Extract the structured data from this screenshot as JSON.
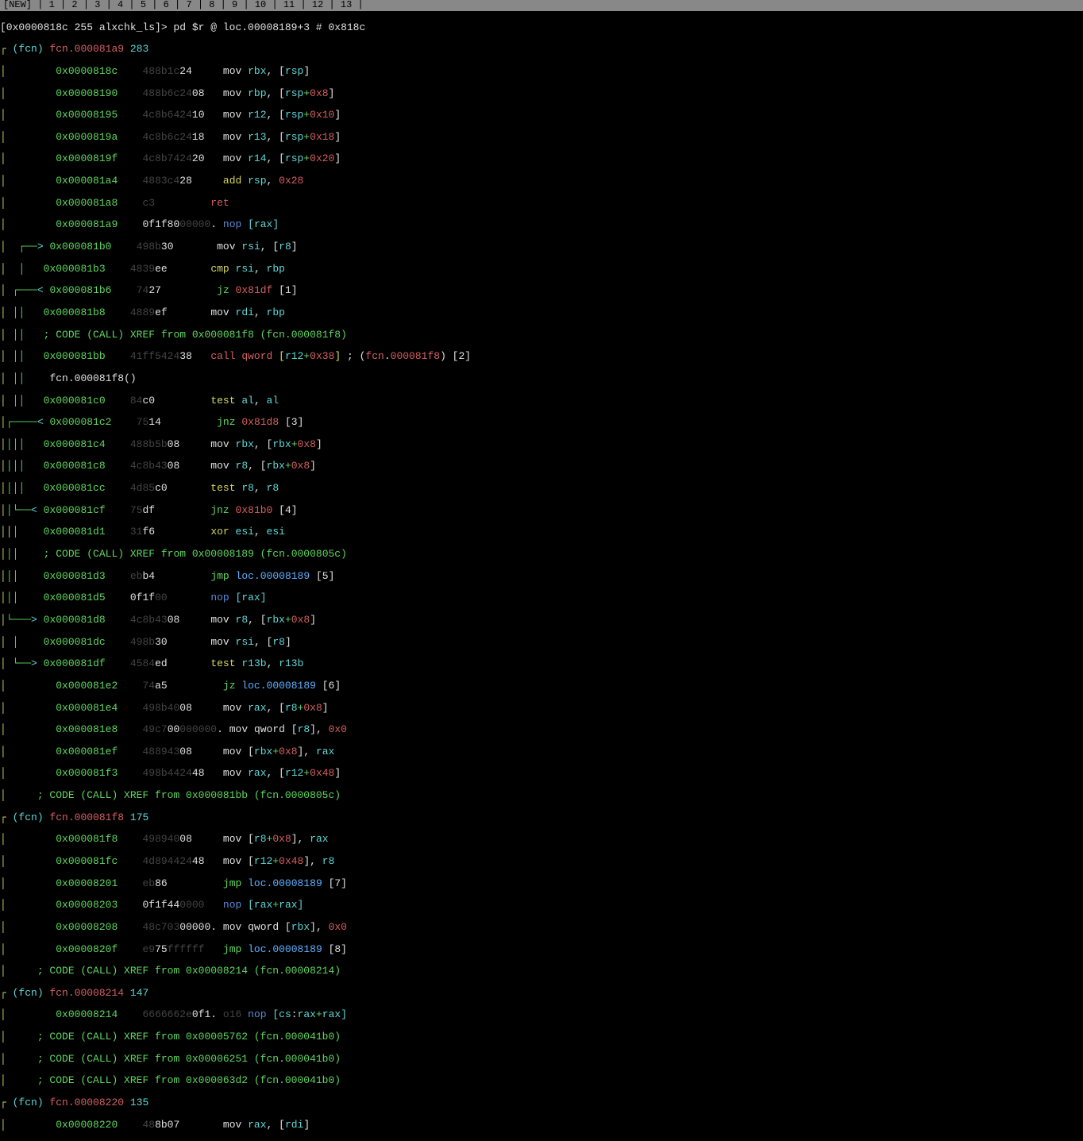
{
  "tabbar": "[NEW] | 1 | 2 | 3 | 4 | 5 | 6 | 7 | 8 | 9 | 10 | 11 | 12 | 13 |",
  "prompt": "[0x0000818c 255 alxchk_ls]> pd $r @ loc.00008189+3 # 0x818c",
  "fcn1": {
    "label": "(fcn)",
    "name": "fcn.000081a9",
    "size": "283"
  },
  "fcn2": {
    "label": "(fcn)",
    "name": "fcn.000081f8",
    "size": "175"
  },
  "fcn3": {
    "label": "(fcn)",
    "name": "fcn.00008214",
    "size": "147"
  },
  "fcn4": {
    "label": "(fcn)",
    "name": "fcn.00008220",
    "size": "135"
  },
  "lines": {
    "l01": {
      "addr": "0x0000818c",
      "hex1": "488b1c",
      "hex2": "24",
      "mn": "mov",
      "op": "rbx, [rsp]"
    },
    "l02": {
      "addr": "0x00008190",
      "hex1": "488b6c24",
      "hex2": "08",
      "mn": "mov",
      "op": "rbp, [rsp+0x8]"
    },
    "l03": {
      "addr": "0x00008195",
      "hex1": "4c8b6424",
      "hex2": "10",
      "mn": "mov",
      "op": "r12, [rsp+0x10]"
    },
    "l04": {
      "addr": "0x0000819a",
      "hex1": "4c8b6c24",
      "hex2": "18",
      "mn": "mov",
      "op": "r13, [rsp+0x18]"
    },
    "l05": {
      "addr": "0x0000819f",
      "hex1": "4c8b7424",
      "hex2": "20",
      "mn": "mov",
      "op": "r14, [rsp+0x20]"
    },
    "l06": {
      "addr": "0x000081a4",
      "hex1": "4883c4",
      "hex2": "28",
      "mn": "add",
      "op": "rsp, 0x28"
    },
    "l07": {
      "addr": "0x000081a8",
      "hex1": "c3",
      "mn": "ret"
    },
    "l08": {
      "addr": "0x000081a9",
      "hex1": "0f1f80",
      "hex2": "00000.",
      "mn": "nop",
      "op": "[rax]"
    },
    "l09": {
      "addr": "0x000081b0",
      "hex1": "498b",
      "hex2": "30",
      "mn": "mov",
      "op": "rsi, [r8]"
    },
    "l10": {
      "addr": "0x000081b3",
      "hex1": "4839",
      "hex2": "ee",
      "mn": "cmp",
      "op": "rsi, rbp"
    },
    "l11": {
      "addr": "0x000081b6",
      "hex1": "74",
      "hex2": "27",
      "mn": "jz",
      "op": "0x81df [1]"
    },
    "l12": {
      "addr": "0x000081b8",
      "hex1": "4889",
      "hex2": "ef",
      "mn": "mov",
      "op": "rdi, rbp"
    },
    "xref1": "; CODE (CALL) XREF from 0x000081f8 (fcn.000081f8)",
    "l13": {
      "addr": "0x000081bb",
      "hex1": "41ff5424",
      "hex2": "38",
      "mn": "call",
      "op": "qword [r12+0x38]",
      "cmt": "; (fcn.000081f8) [2]"
    },
    "fcncall": "fcn.000081f8()",
    "l14": {
      "addr": "0x000081c0",
      "hex1": "84",
      "hex2": "c0",
      "mn": "test",
      "op": "al, al"
    },
    "l15": {
      "addr": "0x000081c2",
      "hex1": "75",
      "hex2": "14",
      "mn": "jnz",
      "op": "0x81d8 [3]"
    },
    "l16": {
      "addr": "0x000081c4",
      "hex1": "488b5b",
      "hex2": "08",
      "mn": "mov",
      "op": "rbx, [rbx+0x8]"
    },
    "l17": {
      "addr": "0x000081c8",
      "hex1": "4c8b43",
      "hex2": "08",
      "mn": "mov",
      "op": "r8, [rbx+0x8]"
    },
    "l18": {
      "addr": "0x000081cc",
      "hex1": "4d85",
      "hex2": "c0",
      "mn": "test",
      "op": "r8, r8"
    },
    "l19": {
      "addr": "0x000081cf",
      "hex1": "75",
      "hex2": "df",
      "mn": "jnz",
      "op": "0x81b0 [4]"
    },
    "l20": {
      "addr": "0x000081d1",
      "hex1": "31",
      "hex2": "f6",
      "mn": "xor",
      "op": "esi, esi"
    },
    "xref2": "; CODE (CALL) XREF from 0x00008189 (fcn.0000805c)",
    "l21": {
      "addr": "0x000081d3",
      "hex1": "eb",
      "hex2": "b4",
      "mn": "jmp",
      "op": "loc.00008189 [5]"
    },
    "l22": {
      "addr": "0x000081d5",
      "hex1": "0f1f",
      "hex2": "00",
      "mn": "nop",
      "op": "[rax]"
    },
    "l23": {
      "addr": "0x000081d8",
      "hex1": "4c8b43",
      "hex2": "08",
      "mn": "mov",
      "op": "r8, [rbx+0x8]"
    },
    "l24": {
      "addr": "0x000081dc",
      "hex1": "498b",
      "hex2": "30",
      "mn": "mov",
      "op": "rsi, [r8]"
    },
    "l25": {
      "addr": "0x000081df",
      "hex1": "4584",
      "hex2": "ed",
      "mn": "test",
      "op": "r13b, r13b"
    },
    "l26": {
      "addr": "0x000081e2",
      "hex1": "74",
      "hex2": "a5",
      "mn": "jz",
      "op": "loc.00008189 [6]"
    },
    "l27": {
      "addr": "0x000081e4",
      "hex1": "498b40",
      "hex2": "08",
      "mn": "mov",
      "op": "rax, [r8+0x8]"
    },
    "l28": {
      "addr": "0x000081e8",
      "hex1": "49c7",
      "hex2": "000000000.",
      "mn": "mov",
      "op": "qword [r8], 0x0"
    },
    "l29": {
      "addr": "0x000081ef",
      "hex1": "488943",
      "hex2": "08",
      "mn": "mov",
      "op": "[rbx+0x8], rax"
    },
    "l30": {
      "addr": "0x000081f3",
      "hex1": "498b4424",
      "hex2": "48",
      "mn": "mov",
      "op": "rax, [r12+0x48]"
    },
    "xref3": "; CODE (CALL) XREF from 0x000081bb (fcn.0000805c)",
    "l31": {
      "addr": "0x000081f8",
      "hex1": "498940",
      "hex2": "08",
      "mn": "mov",
      "op": "[r8+0x8], rax"
    },
    "l32": {
      "addr": "0x000081fc",
      "hex1": "4d894424",
      "hex2": "48",
      "mn": "mov",
      "op": "[r12+0x48], r8"
    },
    "l33": {
      "addr": "0x00008201",
      "hex1": "eb",
      "hex2": "86",
      "mn": "jmp",
      "op": "loc.00008189 [7]"
    },
    "l34": {
      "addr": "0x00008203",
      "hex1": "0f1f44",
      "hex2": "0000",
      "mn": "nop",
      "op": "[rax+rax]"
    },
    "l35": {
      "addr": "0x00008208",
      "hex1": "48c703",
      "hex2": "00000.",
      "mn": "mov",
      "op": "qword [rbx], 0x0"
    },
    "l36": {
      "addr": "0x0000820f",
      "hex1": "e9",
      "hex2": "75ffffff",
      "mn": "jmp",
      "op": "loc.00008189 [8]"
    },
    "xref4": "; CODE (CALL) XREF from 0x00008214 (fcn.00008214)",
    "l37": {
      "addr": "0x00008214",
      "hex1": "6666662e",
      "hex2": "0f1.",
      "mn": "o16 nop",
      "op": "[cs:rax+rax]"
    },
    "xref5": "; CODE (CALL) XREF from 0x00005762 (fcn.000041b0)",
    "xref6": "; CODE (CALL) XREF from 0x00006251 (fcn.000041b0)",
    "xref7": "; CODE (CALL) XREF from 0x000063d2 (fcn.000041b0)",
    "l38": {
      "addr": "0x00008220",
      "hex1": "48",
      "hex2": "8b07",
      "mn": "mov",
      "op": "rax, [rdi]"
    }
  }
}
